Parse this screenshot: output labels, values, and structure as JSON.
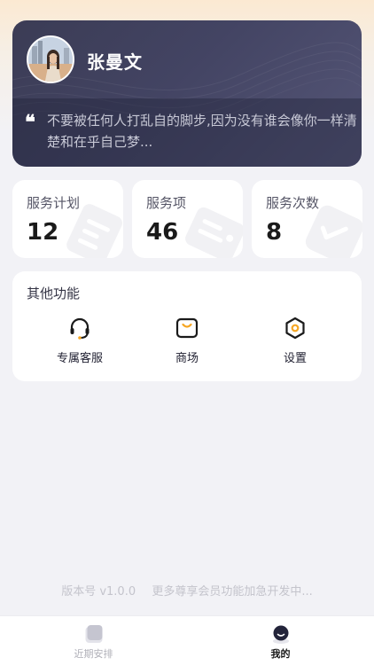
{
  "profile": {
    "name": "张曼文",
    "quote_mark": "❝",
    "quote": "不要被任何人打乱自的脚步,因为没有谁会像你一样清楚和在乎自己梦..."
  },
  "stats": [
    {
      "label": "服务计划",
      "value": "12"
    },
    {
      "label": "服务项",
      "value": "46"
    },
    {
      "label": "服务次数",
      "value": "8"
    }
  ],
  "functions": {
    "title": "其他功能",
    "items": [
      {
        "label": "专属客服",
        "icon": "headset-icon"
      },
      {
        "label": "商场",
        "icon": "shop-box-icon"
      },
      {
        "label": "设置",
        "icon": "settings-hexagon-icon"
      }
    ]
  },
  "footer": {
    "version": "版本号 v1.0.0",
    "message": "更多尊享会员功能加急开发中..."
  },
  "tabbar": {
    "items": [
      {
        "label": "近期安排",
        "icon": "schedule-icon",
        "active": false
      },
      {
        "label": "我的",
        "icon": "profile-icon",
        "active": true
      }
    ]
  },
  "colors": {
    "card_dark": "#3b3c55",
    "accent_orange": "#f5a623",
    "active_tab": "#1a1a1a",
    "inactive_tab": "#b0b0b8"
  }
}
